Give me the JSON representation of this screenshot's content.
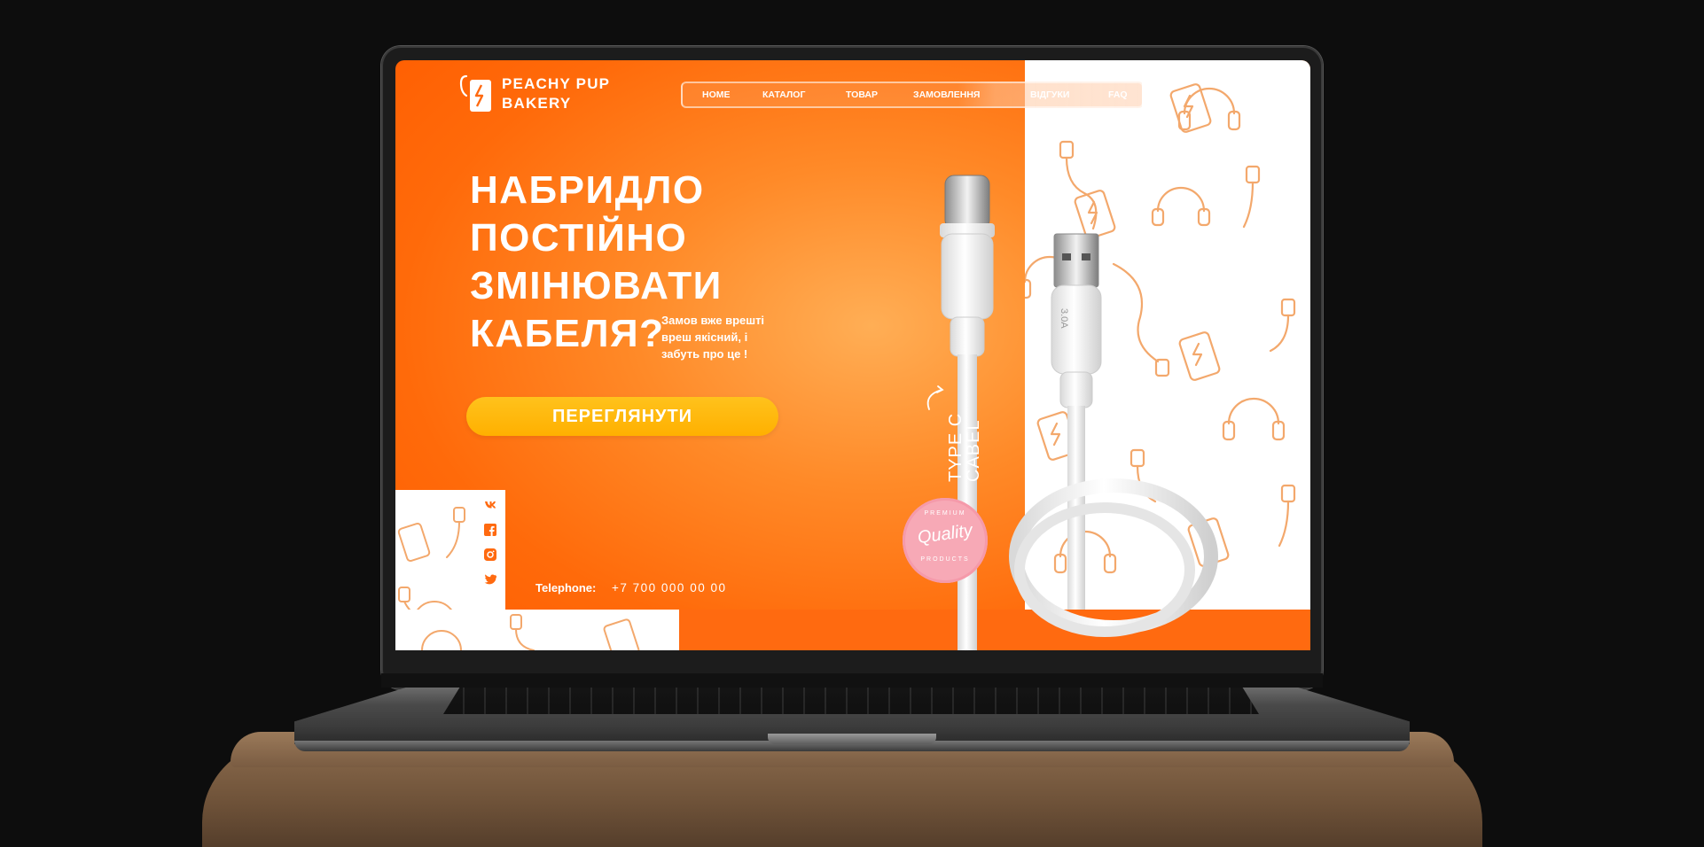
{
  "brand": {
    "line1": "PEACHY PUP",
    "line2": "BAKERY"
  },
  "nav": {
    "items": [
      "HOME",
      "КАТАЛОГ",
      "ТОВАР",
      "ЗАМОВЛЕННЯ",
      "ВІДГУКИ",
      "FAQ"
    ]
  },
  "hero": {
    "headline": [
      "НАБРИДЛО",
      "ПОСТІЙНО",
      "ЗМІНЮВАТИ",
      "КАБЕЛЯ?"
    ],
    "subtext": [
      "Замов вже врешті",
      "вреш якісний, і",
      "забуть про це !"
    ],
    "cta_label": "ПЕРЕГЛЯНУТИ"
  },
  "product": {
    "type_label_line1": "TYPE C",
    "type_label_line2": "CABEL",
    "connector_marking": "3.0A",
    "badge": {
      "top": "PREMIUM",
      "main": "Quality",
      "bottom": "PRODUCTS"
    }
  },
  "contact": {
    "phone_label": "Telephone:",
    "phone_number": "+7 700 000 00 00"
  },
  "social": {
    "icons": [
      "vk-icon",
      "facebook-icon",
      "instagram-icon",
      "twitter-icon"
    ]
  },
  "colors": {
    "primary": "#ff6a10",
    "accent": "#ffb800",
    "pattern": "#f3a86c",
    "badge": "#f7a9b6"
  }
}
